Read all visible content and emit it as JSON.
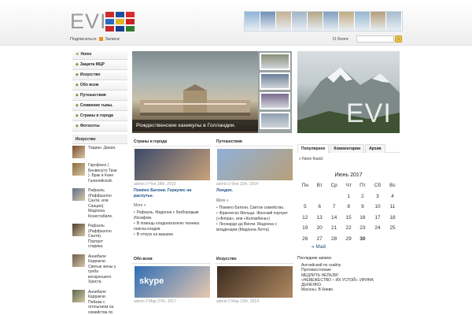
{
  "header": {
    "logo": "EVI",
    "flag_colors": [
      [
        "#cc2a2a",
        "#1f4f9e",
        "#d92c2c"
      ],
      [
        "#2a6bbf",
        "#e1b52a",
        "#cc2222"
      ],
      [
        "#c62828",
        "#1b3f8f",
        "#2f7d32"
      ]
    ],
    "landmark_colors": [
      "#8fb2d6",
      "#6f8fb7",
      "#c4b093",
      "#9fb5c9",
      "#b2a688",
      "#7fa0c0",
      "#c3aa80",
      "#95b7d0",
      "#b59d78",
      "#a7bdd0"
    ],
    "subscribe_label": "Подписаться:",
    "rss_label": "Записи",
    "about_label": "О блоге",
    "search_placeholder": "",
    "search_button": "»"
  },
  "nav": {
    "items": [
      {
        "label": "Home"
      },
      {
        "label": "Защита МЦР"
      },
      {
        "label": "Искусство"
      },
      {
        "label": "Обо всем"
      },
      {
        "label": "Путешествия"
      },
      {
        "label": "Сожжение тьмы."
      },
      {
        "label": "Страны и города"
      },
      {
        "label": "Фотосеты"
      }
    ]
  },
  "sidebar": {
    "heading": "Искусство",
    "items": [
      {
        "lines": [
          "Тициан. Даная."
        ],
        "color": "#7a4a2a"
      },
      {
        "lines": [
          "Гарофало (",
          "Бенвенуто Тизи",
          "). Брак в Кане",
          "Галилейской."
        ],
        "color": "#8b6a3a"
      },
      {
        "lines": [
          "Рафаэль",
          "(Раффаэлло",
          "Санти, или",
          "Санцио).",
          "Мадонна",
          "Конестабиле."
        ],
        "color": "#5f6f8a"
      },
      {
        "lines": [
          "Рафаэль",
          "(Раффаэлло",
          "Санти).",
          "Портрет",
          "старика."
        ],
        "color": "#4a3a2a"
      },
      {
        "lines": [
          "Аннибале",
          "Карракчи.",
          "Святые жены у",
          "гроба",
          "воскресшего",
          "Христа."
        ],
        "color": "#6a5a4a"
      },
      {
        "lines": [
          "Аннибале",
          "Карракчи.",
          "Пейзаж с",
          "отплытием св.",
          "семейства по"
        ],
        "color": "#5a6a4a"
      }
    ]
  },
  "slider": {
    "caption": "Рождественские каникулы в Голландии.",
    "thumb_colors": [
      "#8a8f7a",
      "#6b7f9a",
      "#7a6a8f",
      "#8f9fb0"
    ]
  },
  "posts": [
    {
      "category": "Страны и города",
      "meta": "admin // Ноя 28th, 2013",
      "title": "Помпео Батони. Геркулес на распутье.",
      "more": "More »",
      "links": [
        "Рафаэль. Мадонна с безбородым Иосифом.",
        "В помощь кладоискателю техника поиска кладов",
        "В отпуск на машине"
      ],
      "colors": [
        "#3b4a6a",
        "#c9a27a"
      ]
    },
    {
      "category": "Путешествия",
      "meta": "admin // Фев 11th, 2014",
      "title": "Лондон.",
      "more": "More »",
      "links": [
        "Помпео Батони. Святое семейство.",
        "Франческо Мельци. Женский портрет («Флора», или «Коломбина»)",
        "Леонардо да Винчи. Мадонна с младенцем (Мадонна Литта)"
      ],
      "colors": [
        "#8fb0d8",
        "#b8a07a"
      ]
    },
    {
      "category": "Обо всем",
      "meta": "admin // Мар 27th, 2017",
      "title": "",
      "more": "",
      "links": [],
      "logo_text": "skype",
      "colors": [
        "#2f6fb5",
        "#e8c8b0"
      ]
    },
    {
      "category": "Искусство",
      "meta": "admin // Мар 15th, 2014",
      "title": "",
      "more": "",
      "links": [],
      "colors": [
        "#3a2a1f",
        "#b08a62"
      ]
    }
  ],
  "right": {
    "logo": "EVI",
    "tabs": [
      "Популярное",
      "Комментарии",
      "Архив"
    ],
    "none_found": "» None found",
    "calendar": {
      "title": "Июнь 2017",
      "weekdays": [
        "Пн",
        "Вт",
        "Ср",
        "Чт",
        "Пт",
        "Сб",
        "Вс"
      ],
      "weeks": [
        [
          "",
          "",
          "",
          "1",
          "2",
          "3",
          "4"
        ],
        [
          "5",
          "6",
          "7",
          "8",
          "9",
          "10",
          "11"
        ],
        [
          "12",
          "13",
          "14",
          "15",
          "16",
          "17",
          "18"
        ],
        [
          "19",
          "20",
          "21",
          "22",
          "23",
          "24",
          "25"
        ],
        [
          "26",
          "27",
          "28",
          "29",
          "30",
          "",
          ""
        ]
      ],
      "today": "30",
      "prev": "« Май"
    },
    "recent_heading": "Последние записи",
    "recent": [
      "Английский по скайпу",
      "Противостояние",
      "МЕДЛИТЬ НЕЛЬЗЯ!",
      "«НЕВЕЖЕСТВО – ИХ УСТОЙ». ИРИНА",
      "ДЫЧЕНКО.",
      "Масоны. В Киеве."
    ]
  }
}
